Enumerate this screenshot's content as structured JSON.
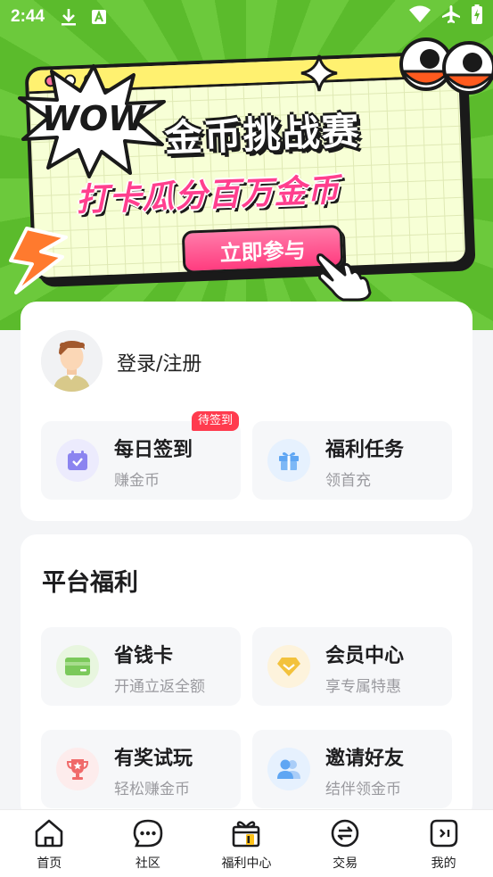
{
  "status_bar": {
    "time": "2:44"
  },
  "banner": {
    "wow_text": "WOW",
    "title": "金币挑战赛",
    "subtitle": "打卡瓜分百万金币",
    "cta_label": "立即参与"
  },
  "user_card": {
    "login_text": "登录/注册",
    "tiles": [
      {
        "title": "每日签到",
        "subtitle": "赚金币",
        "badge": "待签到",
        "icon": "calendar-check-icon",
        "icon_bg": "#ecebfd",
        "icon_color": "#8b84f0"
      },
      {
        "title": "福利任务",
        "subtitle": "领首充",
        "icon": "gift-icon",
        "icon_bg": "#e6f1fe",
        "icon_color": "#5fa6f3"
      }
    ]
  },
  "platform": {
    "title": "平台福利",
    "tiles": [
      {
        "title": "省钱卡",
        "subtitle": "开通立返全额",
        "icon": "card-icon",
        "icon_bg": "#e8f6df",
        "icon_color": "#7bc95a"
      },
      {
        "title": "会员中心",
        "subtitle": "享专属特惠",
        "icon": "diamond-icon",
        "icon_bg": "#fdf3dc",
        "icon_color": "#f3c23c"
      },
      {
        "title": "有奖试玩",
        "subtitle": "轻松赚金币",
        "icon": "trophy-icon",
        "icon_bg": "#fdecec",
        "icon_color": "#f06a6a"
      },
      {
        "title": "邀请好友",
        "subtitle": "结伴领金币",
        "icon": "users-icon",
        "icon_bg": "#e6f1fe",
        "icon_color": "#5fa6f3"
      }
    ]
  },
  "tabbar": {
    "tabs": [
      {
        "label": "首页",
        "icon": "home-icon"
      },
      {
        "label": "社区",
        "icon": "chat-icon"
      },
      {
        "label": "福利中心",
        "icon": "gift-box-icon",
        "active": true
      },
      {
        "label": "交易",
        "icon": "exchange-icon"
      },
      {
        "label": "我的",
        "icon": "profile-icon"
      }
    ]
  }
}
